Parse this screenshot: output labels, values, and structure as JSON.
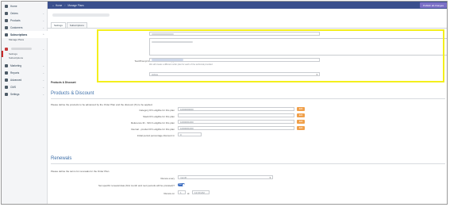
{
  "sidebar": {
    "items": [
      {
        "label": "Home",
        "icon": "home-icon"
      },
      {
        "label": "Orders",
        "icon": "orders-icon"
      },
      {
        "label": "Products",
        "icon": "products-icon"
      },
      {
        "label": "Customers",
        "icon": "customers-icon"
      },
      {
        "label": "Subscriptions",
        "icon": "subscriptions-icon"
      },
      {
        "label": "",
        "icon": "plans-icon"
      },
      {
        "label": "Marketing",
        "icon": "marketing-icon"
      },
      {
        "label": "Reports",
        "icon": "reports-icon"
      },
      {
        "label": "Advanced",
        "icon": "advanced-icon"
      },
      {
        "label": "CMS",
        "icon": "cms-icon"
      },
      {
        "label": "Settings",
        "icon": "settings-icon"
      }
    ],
    "sub_manage_plans": "Manage Plans",
    "sub_settings": "Settings",
    "sub_subscriptions": "Subscriptions"
  },
  "topbar": {
    "crumb_home": "Home",
    "crumb_manage_plans": "Manage Plans",
    "publish_label": "Publish all changes"
  },
  "tabs": [
    "Settings",
    "Subscriptions"
  ],
  "form": {
    "name_label": "Name",
    "description_label": "Description",
    "text_label": "Text/Prompt for which Order Plan applies",
    "text_hint": "We will create a different order plan for each of the technical provided",
    "status_label": "Status",
    "status_value": "Active"
  },
  "products": {
    "small_heading": "Products & Discount",
    "title": "Products & Discount",
    "desc": "Please define the products to be advanced by the Order Plan and the discount (%) to be applied.",
    "rows": [
      {
        "label": "Category ID's eligible for this plan",
        "value": "1000000000"
      },
      {
        "label": "Stack ID's eligible for this plan",
        "value": ""
      },
      {
        "label": "Reference ID - SKU's eligible for this plan",
        "value": "1000001000"
      },
      {
        "label": "Internal - product ID's eligible for this plan",
        "value": "1000001000"
      }
    ],
    "discount_label": "Initial period percentage discount in",
    "discount_value": "0",
    "button_label": "Edit"
  },
  "renewals": {
    "title": "Renewals",
    "desc": "Please define the terms for renewals for the Order Plan",
    "every_label": "Renew every",
    "every_value": "month",
    "specific_label": "Set specific renewal date (first month and next periods will be prorated)?",
    "toggle_label": "Yes",
    "renew_on_label": "Renew on",
    "renew_on_day": "1",
    "renew_on_at": "at",
    "renew_on_time": "12:00 AM"
  },
  "colors": {
    "topbar": "#3a4f8d",
    "publish": "#7b6fc7",
    "highlight": "#f4ef1c",
    "section_title": "#3c6ea8",
    "orange_button": "#f0a04b"
  }
}
